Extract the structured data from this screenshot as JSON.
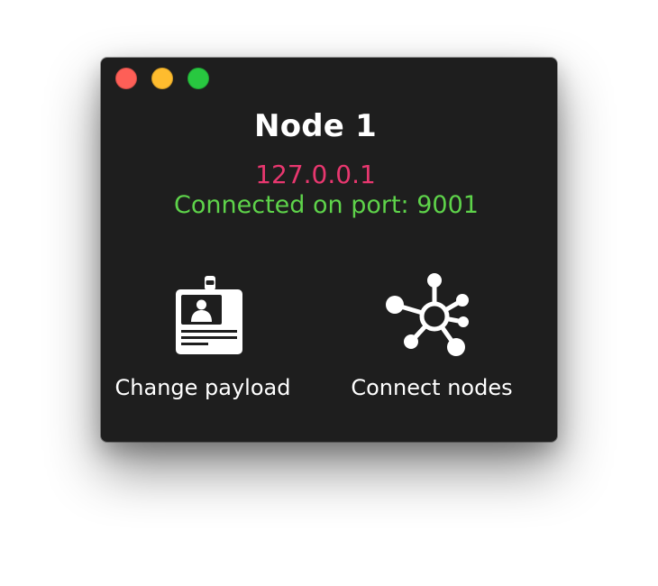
{
  "window": {
    "traffic_lights": {
      "close_color": "#fe5f57",
      "minimize_color": "#febc2e",
      "zoom_color": "#28c840"
    },
    "title": "Node 1",
    "ip_address": "127.0.0.1",
    "status": "Connected on port: 9001",
    "colors": {
      "background": "#1e1e1e",
      "title": "#ffffff",
      "ip": "#e8376f",
      "status": "#5ed34a",
      "icon": "#ffffff"
    }
  },
  "actions": [
    {
      "label": "Change payload",
      "icon": "id-badge-icon"
    },
    {
      "label": "Connect nodes",
      "icon": "network-hub-icon"
    }
  ]
}
